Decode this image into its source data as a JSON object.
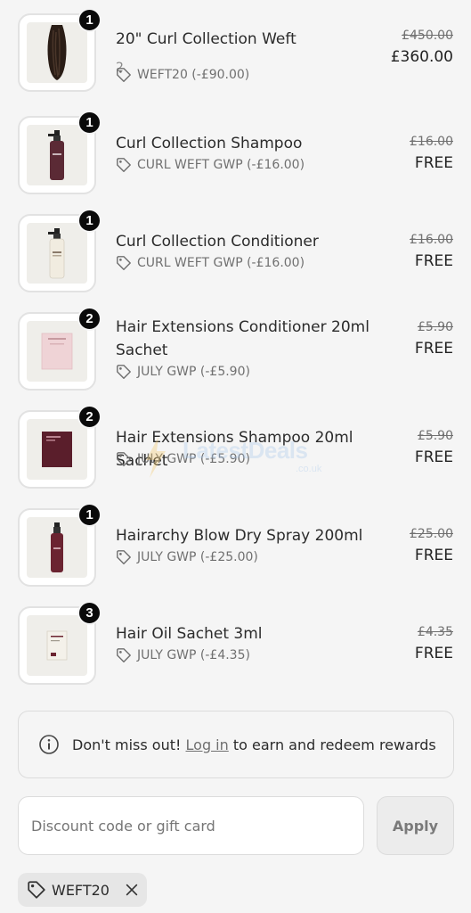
{
  "line_items": [
    {
      "quantity": "1",
      "title": "20\" Curl Collection Weft",
      "variant": "2",
      "discount": "WEFT20 (-£90.00)",
      "original_price": "£450.00",
      "final_price": "£360.00",
      "image": "hair-weft"
    },
    {
      "quantity": "1",
      "title": "Curl Collection Shampoo",
      "discount": "CURL WEFT GWP (-£16.00)",
      "original_price": "£16.00",
      "final_price": "FREE",
      "image": "shampoo-bottle"
    },
    {
      "quantity": "1",
      "title": "Curl Collection Conditioner",
      "discount": "CURL WEFT GWP (-£16.00)",
      "original_price": "£16.00",
      "final_price": "FREE",
      "image": "conditioner-bottle"
    },
    {
      "quantity": "2",
      "title": "Hair Extensions Conditioner 20ml Sachet",
      "discount": "JULY GWP (-£5.90)",
      "original_price": "£5.90",
      "final_price": "FREE",
      "image": "pink-sachet"
    },
    {
      "quantity": "2",
      "title": "Hair Extensions Shampoo 20ml Sachet",
      "discount": "JULY GWP (-£5.90)",
      "original_price": "£5.90",
      "final_price": "FREE",
      "image": "burgundy-sachet"
    },
    {
      "quantity": "1",
      "title": "Hairarchy Blow Dry Spray 200ml",
      "discount": "JULY GWP (-£25.00)",
      "original_price": "£25.00",
      "final_price": "FREE",
      "image": "spray-bottle"
    },
    {
      "quantity": "3",
      "title": "Hair Oil Sachet 3ml",
      "discount": "JULY GWP (-£4.35)",
      "original_price": "£4.35",
      "final_price": "FREE",
      "image": "oil-sachet"
    }
  ],
  "watermark": {
    "text": "LatestDeals",
    "sub": ".co.uk"
  },
  "rewards": {
    "prefix": "Don't miss out!",
    "link": "Log in",
    "suffix": " to earn and redeem rewards"
  },
  "discount": {
    "placeholder": "Discount code or gift card",
    "apply_label": "Apply",
    "applied_code": "WEFT20"
  },
  "colors": {
    "badge": "#0a0a0a",
    "background": "#f5f5f5",
    "muted_text": "#707070"
  }
}
